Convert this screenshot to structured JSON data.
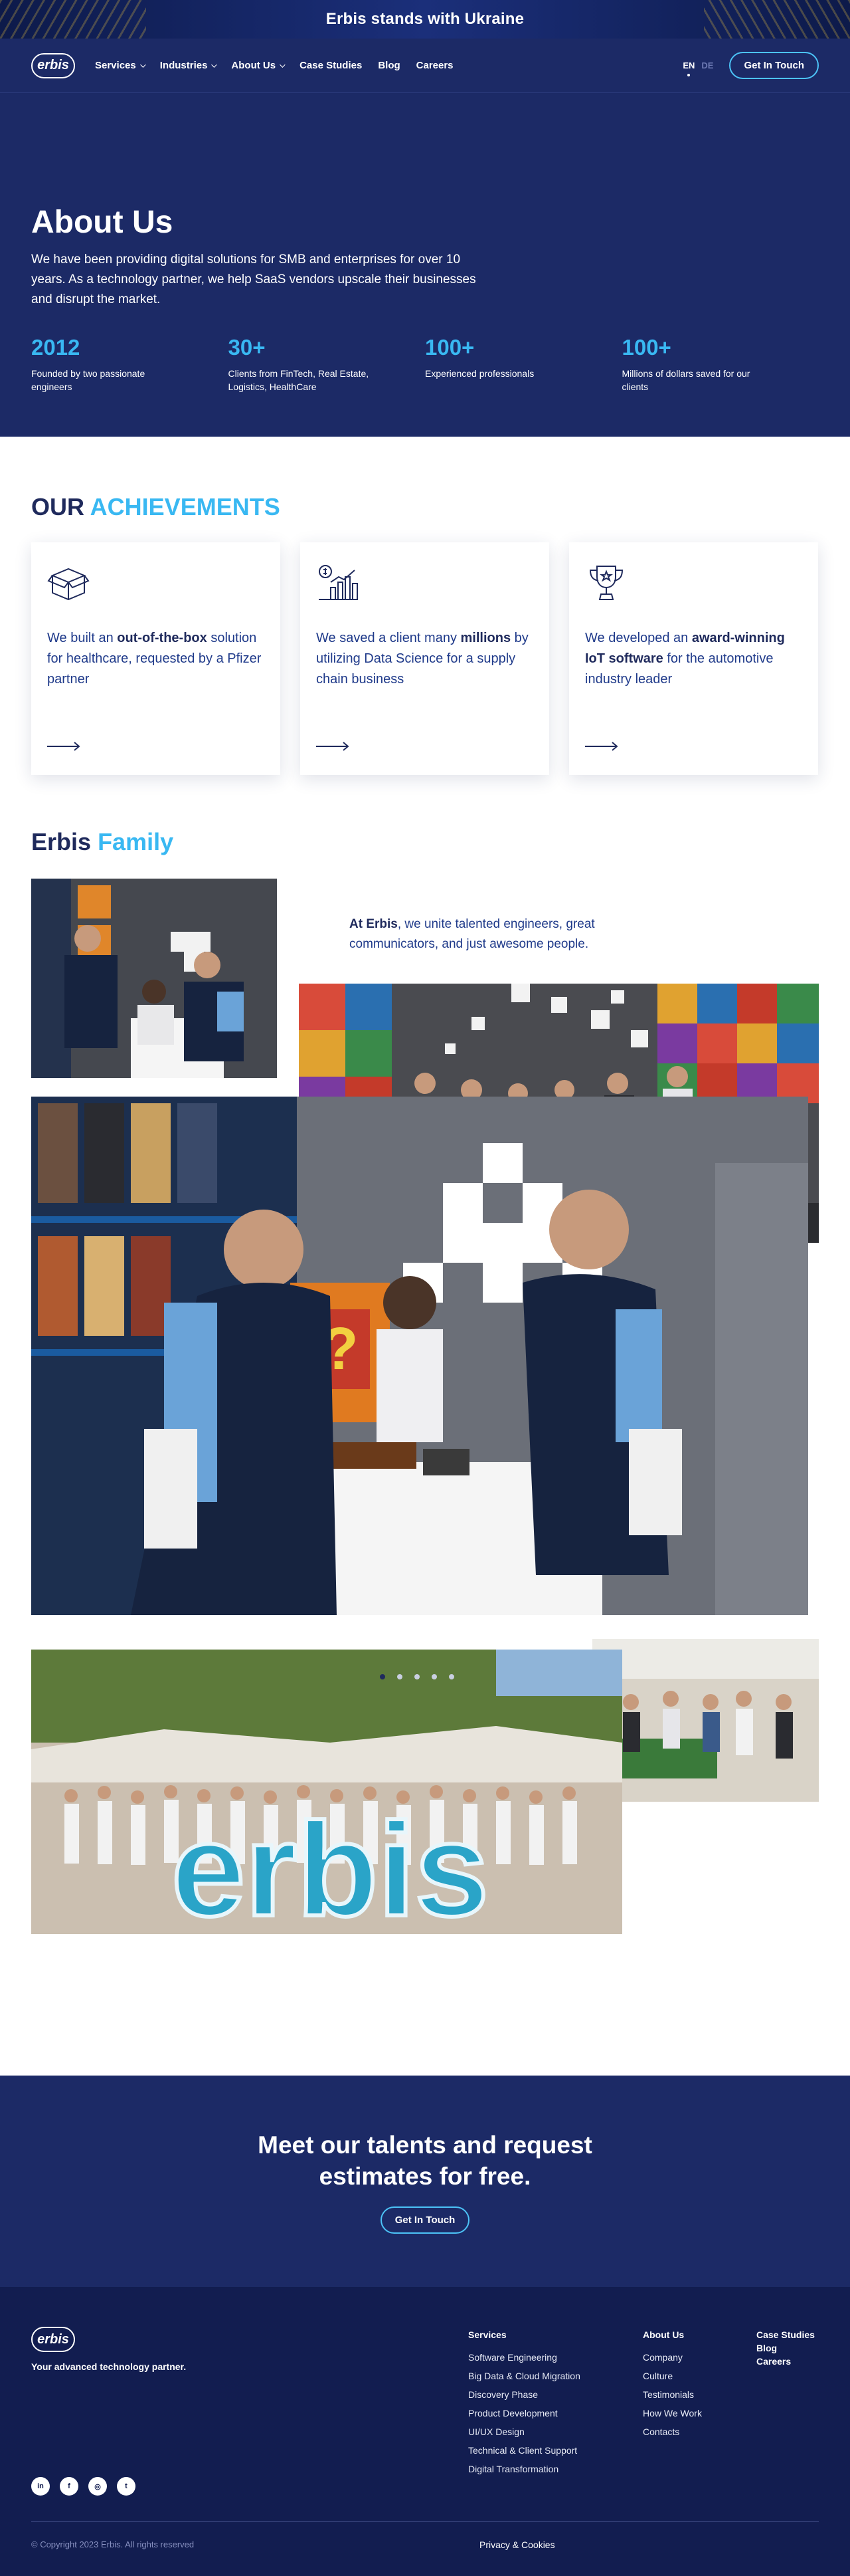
{
  "banner": {
    "text": "Erbis stands with Ukraine"
  },
  "nav": {
    "logo": "erbis",
    "items": [
      {
        "label": "Services",
        "has_dropdown": true
      },
      {
        "label": "Industries",
        "has_dropdown": true
      },
      {
        "label": "About Us",
        "has_dropdown": true
      },
      {
        "label": "Case Studies",
        "has_dropdown": false
      },
      {
        "label": "Blog",
        "has_dropdown": false
      },
      {
        "label": "Careers",
        "has_dropdown": false
      }
    ],
    "lang_active": "EN",
    "lang_inactive": "DE",
    "cta": "Get In Touch"
  },
  "hero": {
    "title": "About Us",
    "description": "We have been providing digital solutions for SMB and enterprises for over 10 years. As a technology partner, we help SaaS vendors upscale their businesses and disrupt the market.",
    "stats": [
      {
        "value": "2012",
        "label": "Founded by two passionate engineers"
      },
      {
        "value": "30+",
        "label": "Clients from FinTech, Real Estate, Logistics, HealthCare"
      },
      {
        "value": "100+",
        "label": "Experienced professionals"
      },
      {
        "value": "100+",
        "label": "Millions of dollars saved for our clients"
      }
    ]
  },
  "achievements": {
    "title_main": "OUR",
    "title_accent": "ACHIEVEMENTS",
    "cards": [
      {
        "icon": "box-icon",
        "before": "We built an ",
        "bold": "out-of-the-box",
        "after": " solution for healthcare, requested by a Pfizer partner"
      },
      {
        "icon": "money-chart-icon",
        "before": "We saved a client many ",
        "bold": "millions",
        "after": " by utilizing Data Science for a supply chain business"
      },
      {
        "icon": "trophy-icon",
        "before": "We developed an ",
        "bold": "award-winning IoT software",
        "after": " for the automotive industry leader"
      }
    ]
  },
  "family": {
    "title_main": "Erbis",
    "title_accent": "Family",
    "text_bold": "At Erbis",
    "text_rest": ", we unite talented engineers, great communicators, and just awesome people.",
    "carousel_pages": 5,
    "carousel_active": 0
  },
  "cta": {
    "title": "Meet our talents and request estimates for free.",
    "button": "Get In Touch"
  },
  "footer": {
    "logo": "erbis",
    "tagline": "Your advanced technology partner.",
    "services": {
      "title": "Services",
      "items": [
        "Software Engineering",
        "Big Data & Cloud Migration",
        "Discovery Phase",
        "Product Development",
        "UI/UX Design",
        "Technical & Client Support",
        "Digital Transformation"
      ]
    },
    "about": {
      "title": "About Us",
      "items": [
        "Company",
        "Culture",
        "Testimonials",
        "How We Work",
        "Contacts"
      ]
    },
    "links": [
      "Case Studies",
      "Blog",
      "Careers"
    ],
    "social": [
      {
        "icon": "linkedin-icon",
        "glyph": "in"
      },
      {
        "icon": "facebook-icon",
        "glyph": "f"
      },
      {
        "icon": "instagram-icon",
        "glyph": "◎"
      },
      {
        "icon": "twitter-icon",
        "glyph": "t"
      }
    ],
    "copyright": "© Copyright 2023 Erbis. All rights reserved",
    "privacy": "Privacy & Cookies"
  },
  "colors": {
    "navy": "#1c2a66",
    "footer": "#121d50",
    "accent": "#39b8f2"
  }
}
